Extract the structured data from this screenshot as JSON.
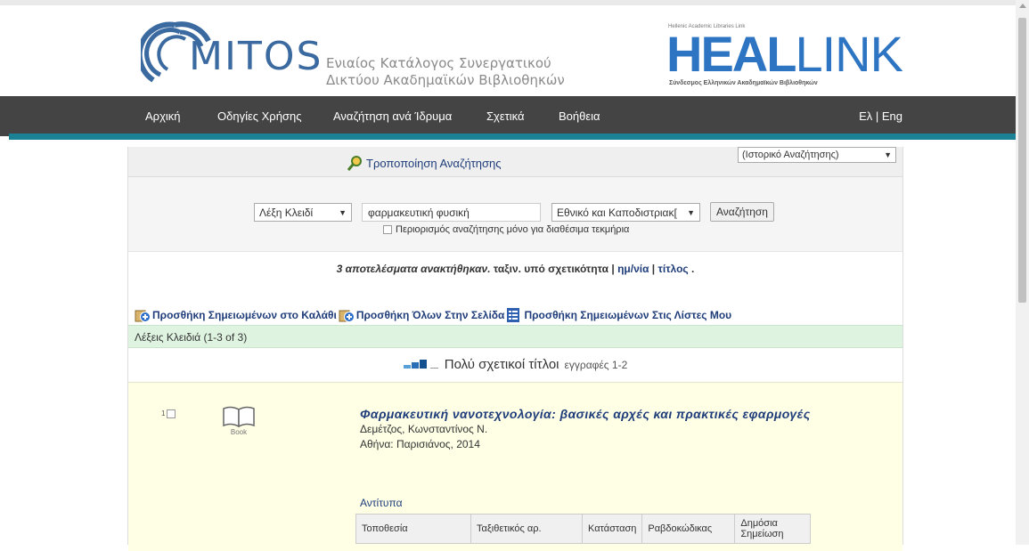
{
  "header": {
    "logo_text": "MITOS",
    "catalog_line1": "Ενιαίος Κατάλογος Συνεργατικού",
    "catalog_line2": "Δικτύου Ακαδημαϊκών Βιβλιοθηκών",
    "heal_sub": "Hellenic Academic Libraries Link",
    "heal_bold": "HEAL",
    "heal_light": "LINK",
    "heal_caption": "Σύνδεσμος Ελληνικών Ακαδημαϊκών Βιβλιοθηκών"
  },
  "nav": {
    "items": [
      {
        "label": "Αρχική"
      },
      {
        "label": "Οδηγίες Χρήσης"
      },
      {
        "label": "Αναζήτηση ανά Ίδρυμα"
      },
      {
        "label": "Σχετικά"
      },
      {
        "label": "Βοήθεια"
      }
    ],
    "lang": "Ελ | Eng"
  },
  "search": {
    "modify_label": "Τροποποίηση Αναζήτησης",
    "history_select": "(Ιστορικό Αναζήτησης)",
    "field_select": "Λέξη Κλειδί",
    "query": "φαρμακευτική φυσική",
    "library_select": "Εθνικό και Καποδιστριακ[",
    "search_button": "Αναζήτηση",
    "restrict_label": "Περιορισμός αναζήτησης μόνο για διαθέσιμα τεκμήρια"
  },
  "results": {
    "msg_italic": "3 αποτελέσματα ανακτήθηκαν.",
    "sort_prefix": "ταξιν. υπό σχετικότητα |",
    "sort_date": "ημ/νία",
    "sort_sep": "|",
    "sort_title": "τίτλος",
    "sort_end": "."
  },
  "actions": {
    "add_marked_cart": "Προσθήκη Σημειωμένων στο Καλάθι",
    "add_all_page": "Προσθήκη Όλων Στην Σελίδα",
    "add_marked_lists": "Προσθήκη Σημειωμένων Στις Λίστες Μου"
  },
  "keywords_bar": "Λέξεις Κλειδιά (1-3 of 3)",
  "relevance": {
    "title": "Πολύ σχετικοί τίτλοι",
    "range": "εγγραφές 1-2"
  },
  "record": {
    "number": "1",
    "type": "Book",
    "title": "Φαρμακευτική νανοτεχνολογία: βασικές αρχές και πρακτικές εφαρμογές",
    "author": "Δεμέτζος, Κωνσταντίνος Ν.",
    "publication": "Αθήνα: Παρισιάνος, 2014",
    "copies_label": "Αντίτυπα",
    "holdings_headers": [
      "Τοποθεσία",
      "Ταξιθετικός αρ.",
      "Κατάσταση",
      "Ραβδοκώδικας",
      "Δημόσια Σημείωση"
    ]
  },
  "colors": {
    "nav_bg": "#444444",
    "nav_accent": "#1b8296",
    "link": "#1f3d7a",
    "keyword_bg": "#dff3e1",
    "record_bg": "#ffffe6"
  }
}
